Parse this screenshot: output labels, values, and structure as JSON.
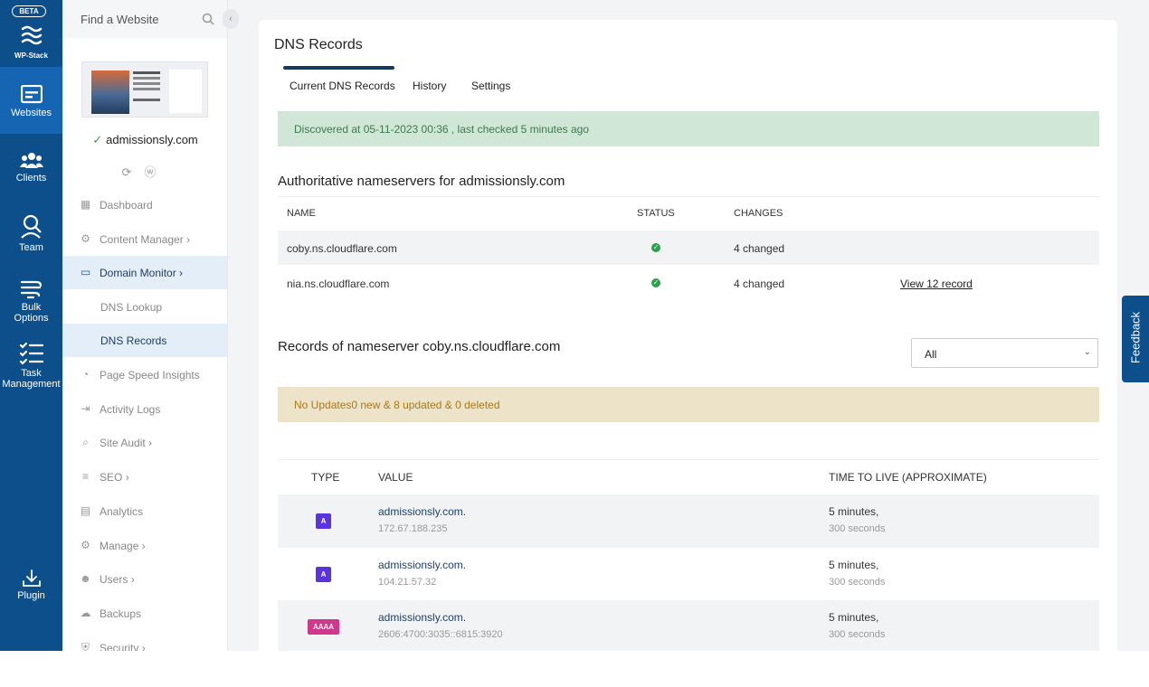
{
  "rail": {
    "badge": "BETA",
    "logo_label": "WP-Stack",
    "items": [
      {
        "label": "Websites",
        "icon": "websites-icon"
      },
      {
        "label": "Clients",
        "icon": "clients-icon"
      },
      {
        "label": "Team",
        "icon": "team-icon"
      },
      {
        "label1": "Bulk",
        "label2": "Options",
        "icon": "bulk-options-icon"
      },
      {
        "label1": "Task",
        "label2": "Management",
        "icon": "task-management-icon"
      },
      {
        "label": "Plugin",
        "icon": "plugin-icon"
      }
    ]
  },
  "sidebar": {
    "search_placeholder": "Find a Website",
    "site_name": "admissionsly.com",
    "nav": [
      {
        "label": "Dashboard",
        "icon": "dashboard-icon"
      },
      {
        "label": "Content Manager",
        "icon": "gear-icon"
      },
      {
        "label": "Domain Monitor",
        "icon": "monitor-icon"
      },
      {
        "label": "DNS Lookup"
      },
      {
        "label": "DNS Records"
      },
      {
        "label": "Page Speed Insights",
        "icon": "speedometer-icon"
      },
      {
        "label": "Activity Logs",
        "icon": "login-icon"
      },
      {
        "label": "Site Audit",
        "icon": "audit-icon"
      },
      {
        "label": "SEO",
        "icon": "seo-icon"
      },
      {
        "label": "Analytics",
        "icon": "analytics-icon"
      },
      {
        "label": "Manage",
        "icon": "gear-icon"
      },
      {
        "label": "Users",
        "icon": "users-icon"
      },
      {
        "label": "Backups",
        "icon": "cloud-icon"
      },
      {
        "label": "Security",
        "icon": "shield-icon"
      }
    ]
  },
  "main": {
    "title": "DNS Records",
    "tabs": [
      "Current DNS Records",
      "History",
      "Settings"
    ],
    "discovered": "Discovered at 05-11-2023 00:36 , last checked 5 minutes ago",
    "ns_heading": "Authoritative nameservers for admissionsly.com",
    "ns_columns": [
      "NAME",
      "STATUS",
      "CHANGES"
    ],
    "nameservers": [
      {
        "name": "coby.ns.cloudflare.com",
        "changes": "4 changed"
      },
      {
        "name": "nia.ns.cloudflare.com",
        "changes": "4 changed",
        "link": "View 12 record"
      }
    ],
    "records_heading": "Records of nameserver coby.ns.cloudflare.com",
    "filter_value": "All",
    "updates": "No Updates0 new & 8 updated & 0 deleted",
    "record_columns": [
      "TYPE",
      "VALUE",
      "TIME TO LIVE (APPROXIMATE)"
    ],
    "records": [
      {
        "type": "A",
        "name": "admissionsly.com.",
        "ip": "172.67.188.235",
        "ttl": "5 minutes,",
        "seconds": "300 seconds"
      },
      {
        "type": "A",
        "name": "admissionsly.com.",
        "ip": "104.21.57.32",
        "ttl": "5 minutes,",
        "seconds": "300 seconds"
      },
      {
        "type": "AAAA",
        "name": "admissionsly.com.",
        "ip": "2606:4700:3035::6815:3920",
        "ttl": "5 minutes,",
        "seconds": "300 seconds"
      }
    ]
  },
  "feedback_label": "Feedback",
  "colors": {
    "rail": "#0d4f8b",
    "rail_active": "#1565b3",
    "success_banner": "#d0e6d6",
    "warning_banner": "#ece3c8",
    "badge_a": "#5b32e0",
    "badge_aaaa": "#d0388b"
  }
}
